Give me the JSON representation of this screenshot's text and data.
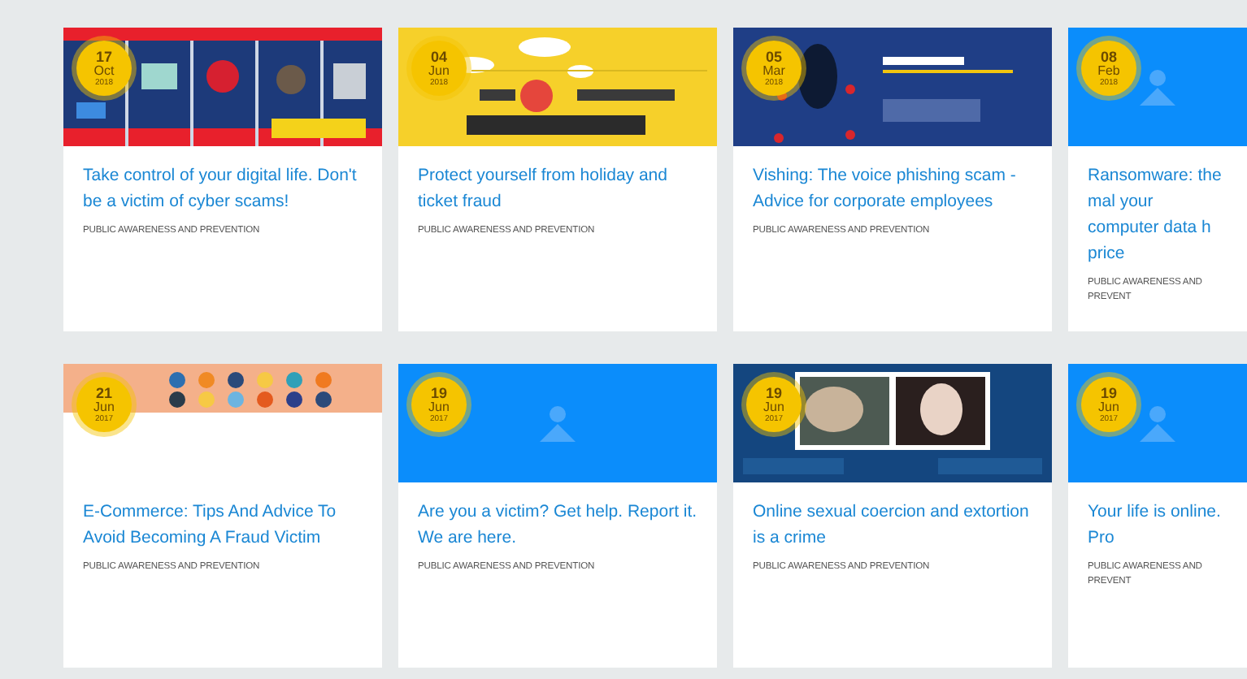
{
  "rows": [
    {
      "cards": [
        {
          "day": "17",
          "month": "Oct",
          "year": "2018",
          "kind": "picture",
          "title": "Take control of your digital life. Don't be a victim of cyber scams!",
          "category": "PUBLIC AWARENESS AND PREVENTION"
        },
        {
          "day": "04",
          "month": "Jun",
          "year": "2018",
          "kind": "picture",
          "title": "Protect yourself from holiday and ticket fraud",
          "category": "PUBLIC AWARENESS AND PREVENTION"
        },
        {
          "day": "05",
          "month": "Mar",
          "year": "2018",
          "kind": "picture",
          "title": "Vishing: The voice phishing scam - Advice for corporate employees",
          "category": "PUBLIC AWARENESS AND PREVENTION"
        },
        {
          "day": "08",
          "month": "Feb",
          "year": "2018",
          "kind": "placeholder",
          "title": "Ransomware: the mal your computer data h price",
          "category": "PUBLIC AWARENESS AND PREVENT"
        }
      ]
    },
    {
      "cards": [
        {
          "day": "21",
          "month": "Jun",
          "year": "2017",
          "kind": "picture",
          "title": "E-Commerce: Tips And Advice To Avoid Becoming A Fraud Victim",
          "category": "PUBLIC AWARENESS AND PREVENTION"
        },
        {
          "day": "19",
          "month": "Jun",
          "year": "2017",
          "kind": "placeholder",
          "title": "Are you a victim? Get help. Report it. We are here.",
          "category": "PUBLIC AWARENESS AND PREVENTION"
        },
        {
          "day": "19",
          "month": "Jun",
          "year": "2017",
          "kind": "picture",
          "title": "Online sexual coercion and extortion is a crime",
          "category": "PUBLIC AWARENESS AND PREVENTION"
        },
        {
          "day": "19",
          "month": "Jun",
          "year": "2017",
          "kind": "placeholder",
          "title": "Your life is online. Pro",
          "category": "PUBLIC AWARENESS AND PREVENT"
        }
      ]
    }
  ]
}
